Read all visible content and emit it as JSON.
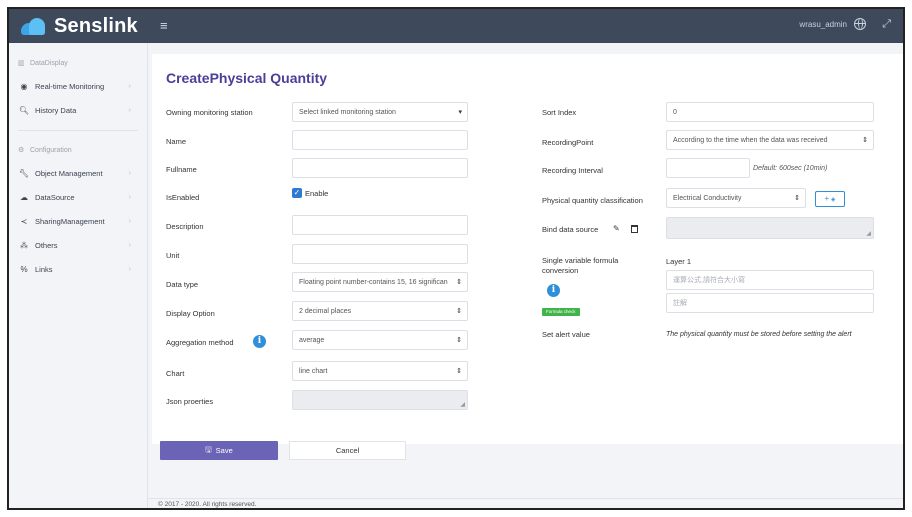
{
  "header": {
    "brand": "Senslink",
    "user": "wrasu_admin"
  },
  "sidebar": {
    "section1": "DataDisplay",
    "item_realtime": "Real-time Monitoring",
    "item_history": "History Data",
    "section2": "Configuration",
    "item_object": "Object Management",
    "item_datasource": "DataSource",
    "item_sharing": "SharingManagement",
    "item_others": "Others",
    "item_links": "Links"
  },
  "form": {
    "title": "CreatePhysical Quantity",
    "labels": {
      "station": "Owning monitoring station",
      "name": "Name",
      "fullname": "Fullname",
      "enabled": "IsEnabled",
      "description": "Description",
      "unit": "Unit",
      "datatype": "Data type",
      "display": "Display Option",
      "aggregation": "Aggregation method",
      "chart": "Chart",
      "json": "Json proerties",
      "sort": "Sort Index",
      "recording_point": "RecordingPoint",
      "recording_interval": "Recording Interval",
      "classification": "Physical quantity classification",
      "bind": "Bind data source",
      "formula": "Single variable formula conversion",
      "alert": "Set alert value"
    },
    "values": {
      "station": "Select linked monitoring station",
      "enable": "Enable",
      "datatype": "Floating point number-contains 15, 16 significan",
      "display": "2 decimal places",
      "aggregation": "average",
      "chart": "line chart",
      "sort": "0",
      "recording_point": "According to the time when the data was received",
      "interval_default": "Default: 600sec (10min)",
      "classification": "Electrical Conductivity",
      "add_button": "+",
      "layer": "Layer 1",
      "formula_ph": "運算公式,請符合大小寫",
      "note_ph": "註解",
      "formula_check": "Formula check",
      "alert_note": "The physical quantity must be stored before setting the alert"
    },
    "save": "Save",
    "cancel": "Cancel"
  },
  "footer": "© 2017 - 2020. All rights reserved."
}
